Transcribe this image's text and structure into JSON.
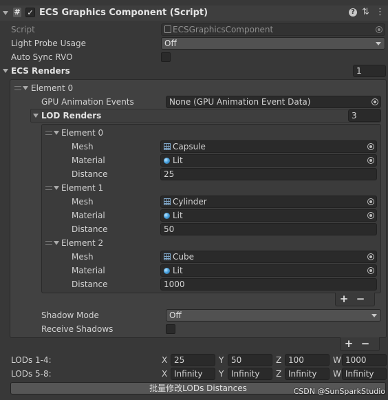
{
  "header": {
    "title": "ECS Graphics Component (Script)",
    "hash_glyph": "#",
    "check_glyph": "✓",
    "help_glyph": "?",
    "settings_glyph": "⇅",
    "menu_glyph": "⋮"
  },
  "script": {
    "label": "Script",
    "value": "ECSGraphicsComponent"
  },
  "light_probe": {
    "label": "Light Probe Usage",
    "value": "Off"
  },
  "auto_sync": {
    "label": "Auto Sync RVO",
    "checked": false
  },
  "ecs_renders": {
    "label": "ECS Renders",
    "count": "1",
    "element0": {
      "label": "Element 0",
      "gpu_anim_label": "GPU Animation Events",
      "gpu_anim_value": "None (GPU Animation Event Data)",
      "lod_renders": {
        "label": "LOD Renders",
        "count": "3",
        "mesh_label": "Mesh",
        "material_label": "Material",
        "distance_label": "Distance",
        "elements": [
          {
            "label": "Element 0",
            "mesh": "Capsule",
            "material": "Lit",
            "distance": "25"
          },
          {
            "label": "Element 1",
            "mesh": "Cylinder",
            "material": "Lit",
            "distance": "50"
          },
          {
            "label": "Element 2",
            "mesh": "Cube",
            "material": "Lit",
            "distance": "1000"
          }
        ]
      },
      "shadow_mode_label": "Shadow Mode",
      "shadow_mode_value": "Off",
      "receive_shadows_label": "Receive Shadows"
    }
  },
  "list_controls": {
    "plus": "+",
    "minus": "−"
  },
  "lods_1_4": {
    "label": "LODs 1-4:",
    "x": "25",
    "y": "50",
    "z": "100",
    "w": "1000"
  },
  "lods_5_8": {
    "label": "LODs 5-8:",
    "x": "Infinity",
    "y": "Infinity",
    "z": "Infinity",
    "w": "Infinity"
  },
  "axis": {
    "x": "X",
    "y": "Y",
    "z": "Z",
    "w": "W"
  },
  "batch_button": "批量修改LODs Distances",
  "watermark": "CSDN @SunSparkStudio"
}
